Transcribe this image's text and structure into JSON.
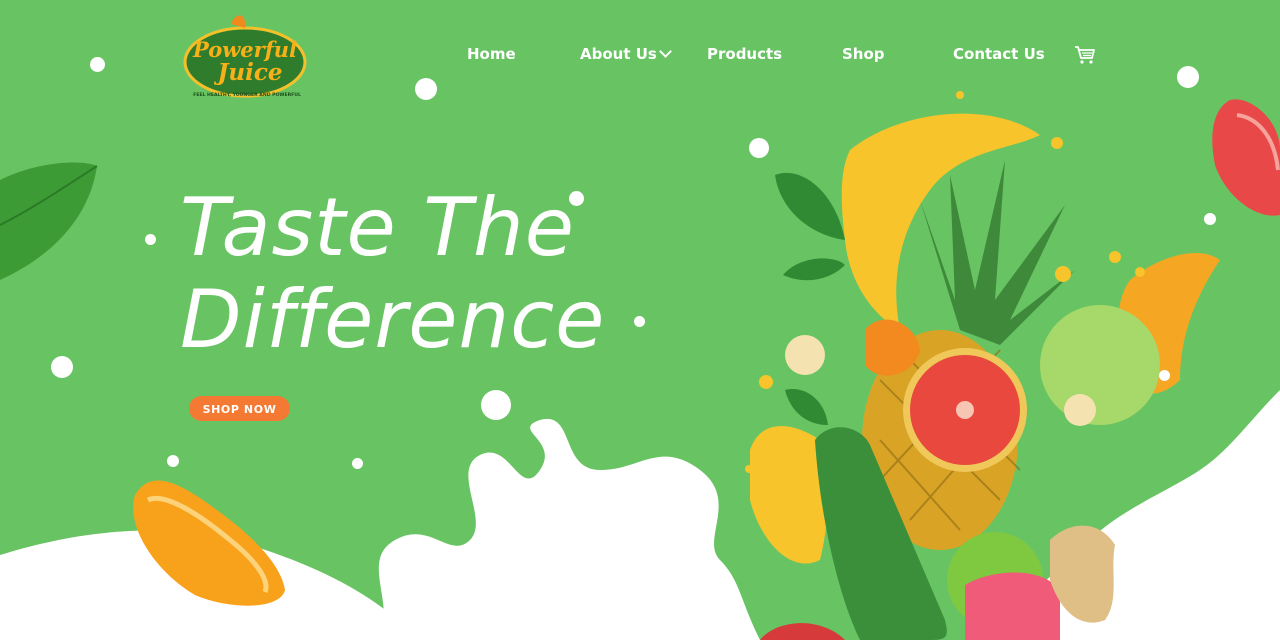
{
  "brand": {
    "logo_line1": "Powerful",
    "logo_line2": "Juice",
    "tagline": "FEEL HEALTHY, YOUNGER AND POWERFUL"
  },
  "nav": {
    "items": [
      {
        "label": "Home"
      },
      {
        "label": "About Us"
      },
      {
        "label": "Products"
      },
      {
        "label": "Shop"
      },
      {
        "label": "Contact Us"
      }
    ]
  },
  "hero": {
    "title_line1": "Taste The",
    "title_line2": "Difference",
    "cta_label": "SHOP NOW"
  },
  "colors": {
    "background": "#68c463",
    "accent": "#f47a33",
    "text": "#ffffff"
  },
  "icons": {
    "cart": "cart-icon",
    "dropdown": "chevron-down-icon"
  }
}
